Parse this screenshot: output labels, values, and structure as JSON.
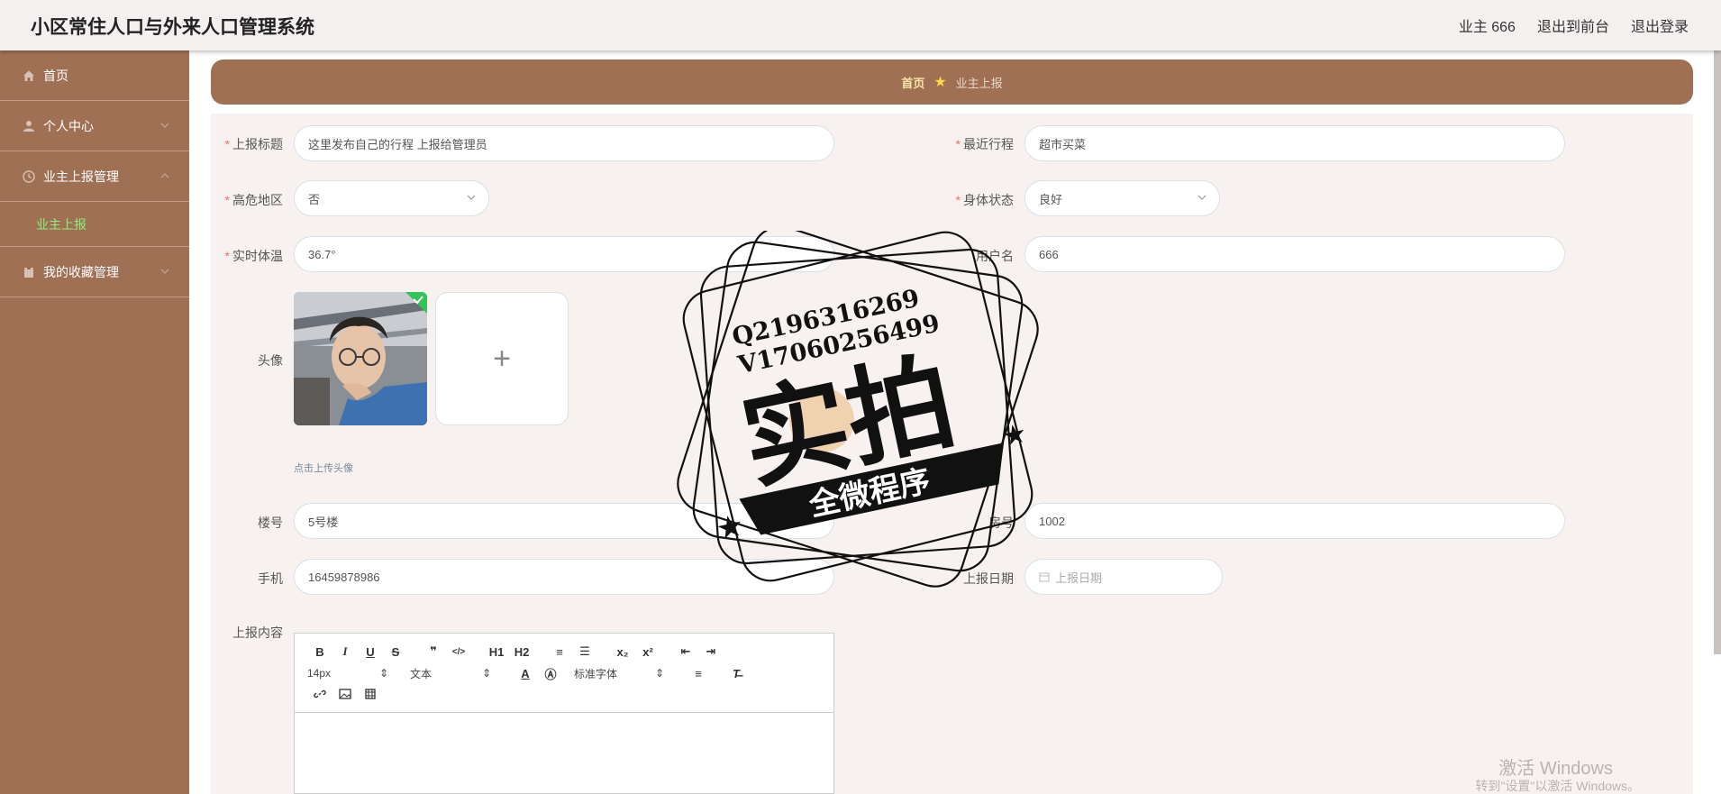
{
  "header": {
    "title": "小区常住人口与外来人口管理系统",
    "links": [
      "业主 666",
      "退出到前台",
      "退出登录"
    ]
  },
  "sidebar": {
    "items": [
      {
        "label": "首页"
      },
      {
        "label": "个人中心"
      },
      {
        "label": "业主上报管理"
      },
      {
        "label": "我的收藏管理"
      }
    ],
    "sub_item": "业主上报"
  },
  "breadcrumb": {
    "home": "首页",
    "current": "业主上报"
  },
  "form": {
    "title_label": "上报标题",
    "title_value": "这里发布自己的行程 上报给管理员",
    "route_label": "最近行程",
    "route_value": "超市买菜",
    "risk_label": "高危地区",
    "risk_value": "否",
    "health_label": "身体状态",
    "health_value": "良好",
    "temp_label": "实时体温",
    "temp_value": "36.7°",
    "user_label": "用户名",
    "user_value": "666",
    "avatar_label": "头像",
    "upload_plus": "+",
    "upload_hint": "点击上传头像",
    "building_label": "楼号",
    "building_value": "5号楼",
    "room_label": "房号",
    "room_value": "1002",
    "phone_label": "手机",
    "phone_value": "16459878986",
    "date_label": "上报日期",
    "date_placeholder": "上报日期",
    "content_label": "上报内容"
  },
  "editor": {
    "row1": [
      "B",
      "I",
      "U",
      "S",
      "❞",
      "</>",
      "H1",
      "H2",
      "≡",
      "☰",
      "x₂",
      "x²",
      "⇤",
      "⇥"
    ],
    "font_size": "14px",
    "block_type": "文本",
    "font_family": "标准字体"
  },
  "watermark": {
    "line1": "Q2196316269",
    "line2": "V17060256499",
    "big": "实拍",
    "ribbon": "全微程序"
  },
  "windows_activation": {
    "line1": "激活 Windows",
    "line2": "转到\"设置\"以激活 Windows。"
  }
}
